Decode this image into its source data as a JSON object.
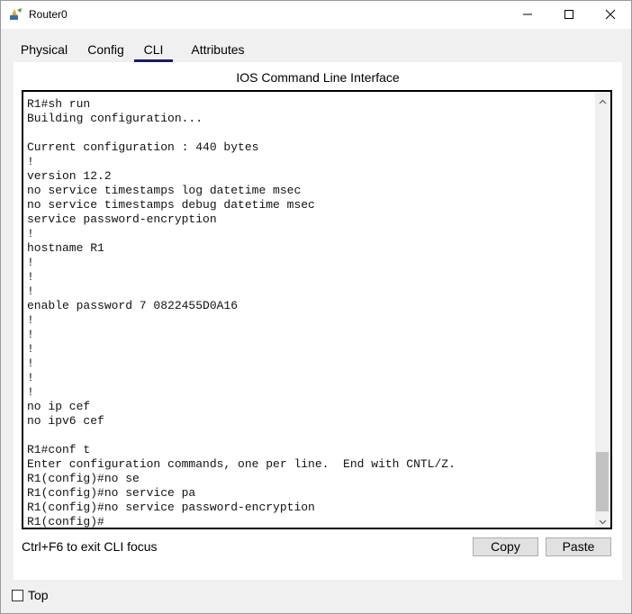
{
  "window": {
    "title": "Router0",
    "icon": "router-device-icon",
    "controls": [
      "minimize-icon",
      "maximize-icon",
      "close-icon"
    ]
  },
  "tabs": [
    {
      "label": "Physical",
      "active": false
    },
    {
      "label": "Config",
      "active": false
    },
    {
      "label": "CLI",
      "active": true
    },
    {
      "label": "Attributes",
      "active": false
    }
  ],
  "cli": {
    "heading": "IOS Command Line Interface",
    "lines": [
      "R1#sh run",
      "Building configuration...",
      "",
      "Current configuration : 440 bytes",
      "!",
      "version 12.2",
      "no service timestamps log datetime msec",
      "no service timestamps debug datetime msec",
      "service password-encryption",
      "!",
      "hostname R1",
      "!",
      "!",
      "!",
      "enable password 7 0822455D0A16",
      "!",
      "!",
      "!",
      "!",
      "!",
      "!",
      "no ip cef",
      "no ipv6 cef",
      "",
      "R1#conf t",
      "Enter configuration commands, one per line.  End with CNTL/Z.",
      "R1(config)#no se",
      "R1(config)#no service pa",
      "R1(config)#no service password-encryption",
      "R1(config)#"
    ],
    "focus_hint": "Ctrl+F6 to exit CLI focus",
    "copy_label": "Copy",
    "paste_label": "Paste"
  },
  "footer": {
    "top_label": "Top",
    "top_checked": false
  }
}
